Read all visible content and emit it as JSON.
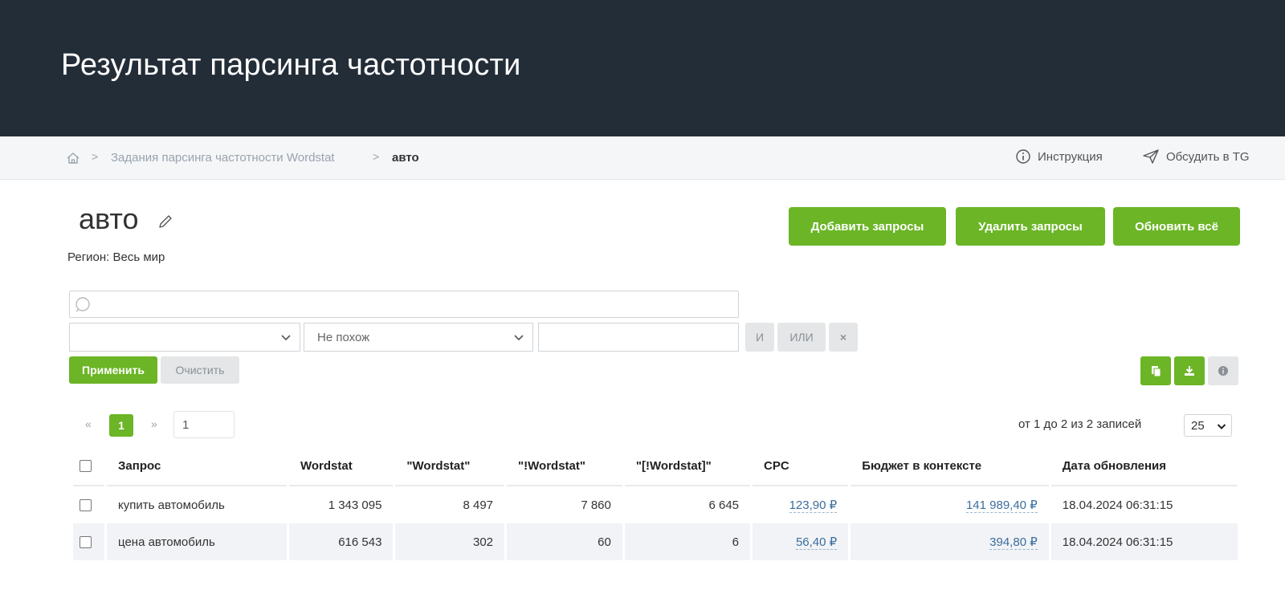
{
  "header": {
    "title": "Результат парсинга частотности"
  },
  "breadcrumb": {
    "parent": "Задания парсинга частотности Wordstat",
    "current": "авто",
    "instruction_label": "Инструкция",
    "discuss_label": "Обсудить в TG"
  },
  "page": {
    "title": "авто",
    "region": "Регион: Весь мир"
  },
  "actions": {
    "add": "Добавить запросы",
    "delete": "Удалить запросы",
    "refresh": "Обновить всё"
  },
  "filters": {
    "search_value": "",
    "field_select_value": "",
    "condition_select_value": "Не похож",
    "text_value": "",
    "and_label": "И",
    "or_label": "ИЛИ",
    "remove_label": "×",
    "apply_label": "Применить",
    "clear_label": "Очистить"
  },
  "pagination": {
    "prev": "«",
    "current": "1",
    "next": "»",
    "goto_value": "1",
    "records_text": "от 1 до 2 из 2 записей",
    "per_page": "25"
  },
  "table": {
    "columns": [
      "Запрос",
      "Wordstat",
      "\"Wordstat\"",
      "\"!Wordstat\"",
      "\"[!Wordstat]\"",
      "CPC",
      "Бюджет в контексте",
      "Дата обновления"
    ],
    "rows": [
      {
        "query": "купить автомобиль",
        "wordstat": "1 343 095",
        "wordstat_quoted": "8 497",
        "wordstat_excl": "7 860",
        "wordstat_exact": "6 645",
        "cpc": "123,90 ₽",
        "budget": "141 989,40 ₽",
        "updated": "18.04.2024 06:31:15"
      },
      {
        "query": "цена автомобиль",
        "wordstat": "616 543",
        "wordstat_quoted": "302",
        "wordstat_excl": "60",
        "wordstat_exact": "6",
        "cpc": "56,40 ₽",
        "budget": "394,80 ₽",
        "updated": "18.04.2024 06:31:15"
      }
    ]
  },
  "colors": {
    "header_bg": "#232d38",
    "accent_green": "#6bb526",
    "link_blue": "#3b6d9e"
  }
}
